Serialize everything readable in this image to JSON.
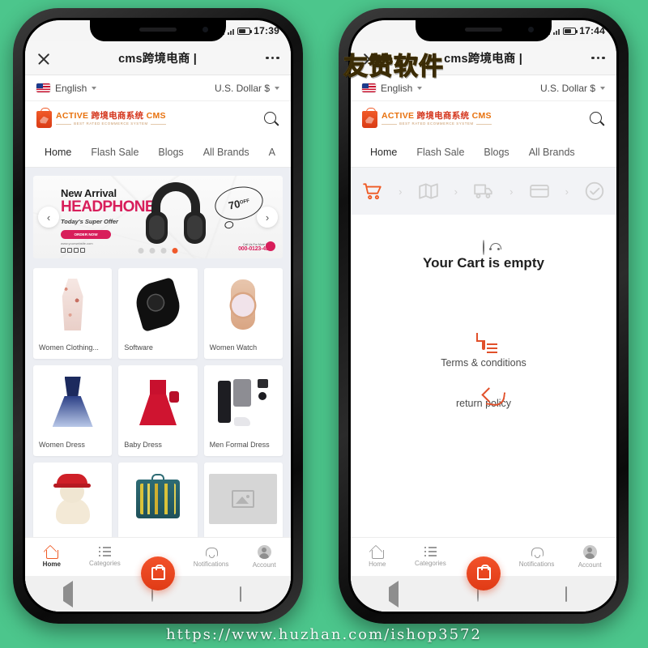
{
  "background_color": "#4cc68c",
  "watermarks": {
    "chinese_label": "友赞软件",
    "url": "https://www.huzhan.com/ishop3572"
  },
  "phones": [
    {
      "id": "left",
      "status_bar": {
        "time": "17:39"
      },
      "appbar": {
        "close_label": "×",
        "title": "cms跨境电商 |",
        "menu_label": "•••"
      },
      "locale_bar": {
        "language": "English",
        "currency": "U.S. Dollar $"
      },
      "brand": {
        "name_en": "ACTIVE",
        "name_cn": "跨境电商系统",
        "suffix": "CMS",
        "tagline": "BEST RATED ECOMMERCE SYSTEM",
        "search_icon": "search-icon"
      },
      "nav_tabs": [
        {
          "label": "Home",
          "active": true
        },
        {
          "label": "Flash Sale",
          "active": false
        },
        {
          "label": "Blogs",
          "active": false
        },
        {
          "label": "All Brands",
          "active": false
        },
        {
          "label": "A",
          "active": false
        }
      ],
      "hero": {
        "line1": "New Arrival",
        "line2": "HEADPHONE",
        "line3": "Today's Super Offer",
        "cta": "ORDER NOW",
        "url": "www.yourwebsite.com",
        "discount": "70",
        "discount_suffix": "OFF",
        "call_label": "Call Us For More Details",
        "phone": "000-0123-4567",
        "prev_icon": "chevron-left-icon",
        "next_icon": "chevron-right-icon",
        "slides": 4,
        "active_slide": 4
      },
      "products": [
        {
          "label": "Women Clothing...",
          "art": "a-dress1"
        },
        {
          "label": "Software",
          "art": "a-watchB"
        },
        {
          "label": "Women Watch",
          "art": "a-watchG"
        },
        {
          "label": "Women Dress",
          "art": "a-gown"
        },
        {
          "label": "Baby Dress",
          "art": "a-red"
        },
        {
          "label": "Men Formal Dress",
          "art": "a-men"
        },
        {
          "label": "",
          "art": "a-bear"
        },
        {
          "label": "",
          "art": "a-tool"
        },
        {
          "label": "",
          "art": "a-ph"
        }
      ],
      "tabbar": [
        {
          "label": "Home",
          "icon": "home-icon",
          "active": true
        },
        {
          "label": "Categories",
          "icon": "categories-icon",
          "active": false
        },
        {
          "label": "Cart (0)",
          "icon": "cart-icon",
          "active": false
        },
        {
          "label": "Notifications",
          "icon": "bell-icon",
          "active": false
        },
        {
          "label": "Account",
          "icon": "account-icon",
          "active": false
        }
      ]
    },
    {
      "id": "right",
      "status_bar": {
        "time": "17:44"
      },
      "appbar": {
        "close_label": "×",
        "title": "cms跨境电商 |",
        "menu_label": "•••"
      },
      "locale_bar": {
        "language": "English",
        "currency": "U.S. Dollar $"
      },
      "brand": {
        "name_en": "ACTIVE",
        "name_cn": "跨境电商系统",
        "suffix": "CMS",
        "tagline": "BEST RATED ECOMMERCE SYSTEM",
        "search_icon": "search-icon"
      },
      "nav_tabs": [
        {
          "label": "Home",
          "active": true
        },
        {
          "label": "Flash Sale",
          "active": false
        },
        {
          "label": "Blogs",
          "active": false
        },
        {
          "label": "All Brands",
          "active": false
        }
      ],
      "checkout_steps": [
        {
          "icon": "cart-step-icon",
          "active": true
        },
        {
          "icon": "map-step-icon",
          "active": false
        },
        {
          "icon": "truck-step-icon",
          "active": false
        },
        {
          "icon": "card-step-icon",
          "active": false
        },
        {
          "icon": "check-step-icon",
          "active": false
        }
      ],
      "cart": {
        "empty_icon": "sad-face-icon",
        "empty_message": "Your Cart is empty"
      },
      "links": [
        {
          "label": "Terms & conditions",
          "icon": "document-icon"
        },
        {
          "label": "return policy",
          "icon": "return-arrow-icon"
        }
      ],
      "tabbar": [
        {
          "label": "Home",
          "icon": "home-icon",
          "active": false
        },
        {
          "label": "Categories",
          "icon": "categories-icon",
          "active": false
        },
        {
          "label": "Cart (0)",
          "icon": "cart-icon",
          "active": true
        },
        {
          "label": "Notifications",
          "icon": "bell-icon",
          "active": false
        },
        {
          "label": "Account",
          "icon": "account-icon",
          "active": false
        }
      ]
    }
  ]
}
